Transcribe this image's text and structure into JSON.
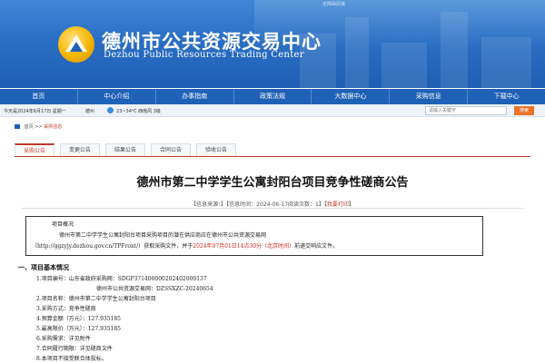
{
  "header": {
    "top_tiny": "无障碍阅读",
    "title": "德州市公共资源交易中心",
    "subtitle": "Dezhou Public Resources Trading Center"
  },
  "nav": {
    "items": [
      "首页",
      "中心介绍",
      "办事指南",
      "政策法规",
      "大数据中心",
      "采购信息",
      "下载中心"
    ]
  },
  "infobar": {
    "date": "今天是2024年6月17日 星期一",
    "city": "德州",
    "temp": "23~34℃ 西南风 3级",
    "search_placeholder": "请输入关键字",
    "search_button": "搜索"
  },
  "breadcrumb": {
    "home": "首页",
    "sep": ">>",
    "current": "采购信息"
  },
  "tabs": [
    "采购公告",
    "变更公告",
    "结果公告",
    "合同公告",
    "验收公告"
  ],
  "document": {
    "title": "德州市第二中学学生公寓封阳台项目竞争性磋商公告",
    "meta_prefix": "【信息来源：】【信息时间：2024-06-17阅读次数：1】【",
    "meta_print": "我要打印",
    "meta_suffix": "】",
    "box": {
      "line1": "项目概况",
      "line2": "德州市第二中学学生公寓封阳台项目采购项目的潜在供应商应在德州市公共资源交易网",
      "line3_a": "（http://ggzyjy.dezhou.gov.cn/TPFront/）获取采购文件，并于",
      "line3_red": "2024年07月01日14点30分（北京时间）",
      "line3_b": "前递交响应文件。"
    },
    "section1": "一、项目基本情况",
    "lines": [
      "1.项目编号：山东省政府采购网：SDGP371400000202402000137",
      "德州市公共资源交易网：DZSSXZC-20240654",
      "2.项目名称：德州市第二中学学生公寓封阳台项目",
      "3.采购方式：竞争性磋商",
      "4.预算金额（万元）：127.935185",
      "5.最高限价（万元）：127.935185",
      "6.采购需求：详见附件",
      "7.合同履行期限：详见磋商文件",
      "8.本项目不接受联合体投标。"
    ]
  },
  "colors": {
    "header_blue": "#2a6fc4",
    "nav_blue": "#1f61b6",
    "accent_red": "#c0392b",
    "search_orange": "#e8742a"
  }
}
